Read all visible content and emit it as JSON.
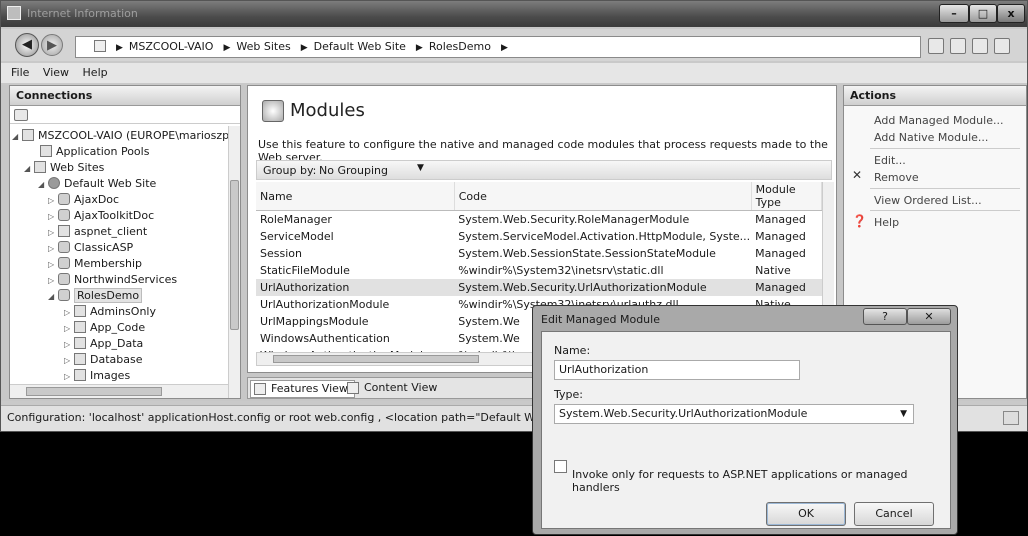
{
  "window": {
    "title": "Internet Information"
  },
  "address": {
    "crumbs": [
      "MSZCOOL-VAIO",
      "Web Sites",
      "Default Web Site",
      "RolesDemo"
    ]
  },
  "menu": [
    "File",
    "View",
    "Help"
  ],
  "connections": {
    "title": "Connections",
    "tree": [
      {
        "label": "MSZCOOL-VAIO (EUROPE\\marioszp)",
        "expander": "◢",
        "icon": "server-icon"
      },
      {
        "label": "Application Pools",
        "expander": "",
        "icon": "folder-icon"
      },
      {
        "label": "Web Sites",
        "expander": "◢",
        "icon": "folder-icon"
      },
      {
        "label": "Default Web Site",
        "expander": "◢",
        "icon": "globe-icon"
      },
      {
        "label": "AjaxDoc",
        "expander": "▷",
        "icon": "app-icon"
      },
      {
        "label": "AjaxToolkitDoc",
        "expander": "▷",
        "icon": "app-icon"
      },
      {
        "label": "aspnet_client",
        "expander": "▷",
        "icon": "folder-icon"
      },
      {
        "label": "ClassicASP",
        "expander": "▷",
        "icon": "app-icon"
      },
      {
        "label": "Membership",
        "expander": "▷",
        "icon": "app-icon"
      },
      {
        "label": "NorthwindServices",
        "expander": "▷",
        "icon": "app-icon"
      },
      {
        "label": "RolesDemo",
        "expander": "◢",
        "icon": "app-icon"
      },
      {
        "label": "AdminsOnly",
        "expander": "▷",
        "icon": "folder-icon"
      },
      {
        "label": "App_Code",
        "expander": "▷",
        "icon": "folder-icon"
      },
      {
        "label": "App_Data",
        "expander": "▷",
        "icon": "folder-icon"
      },
      {
        "label": "Database",
        "expander": "▷",
        "icon": "folder-icon"
      },
      {
        "label": "Images",
        "expander": "▷",
        "icon": "folder-icon"
      }
    ]
  },
  "main": {
    "title": "Modules",
    "description": "Use this feature to configure the native and managed code modules that process requests made to the Web server.",
    "group_by_label": "Group by:",
    "group_by_value": "No Grouping",
    "columns": [
      "Name",
      "Code",
      "Module Type"
    ],
    "rows": [
      [
        "RoleManager",
        "System.Web.Security.RoleManagerModule",
        "Managed"
      ],
      [
        "ServiceModel",
        "System.ServiceModel.Activation.HttpModule, Syste...",
        "Managed"
      ],
      [
        "Session",
        "System.Web.SessionState.SessionStateModule",
        "Managed"
      ],
      [
        "StaticFileModule",
        "%windir%\\System32\\inetsrv\\static.dll",
        "Native"
      ],
      [
        "UrlAuthorization",
        "System.Web.Security.UrlAuthorizationModule",
        "Managed"
      ],
      [
        "UrlAuthorizationModule",
        "%windir%\\System32\\inetsrv\\urlauthz.dll",
        "Native"
      ],
      [
        "UrlMappingsModule",
        "System.We",
        ""
      ],
      [
        "WindowsAuthentication",
        "System.We",
        ""
      ],
      [
        "WindowsAuthenticationModule",
        "%windir%\\",
        ""
      ]
    ],
    "selected_row": 4,
    "tabs": [
      "Features View",
      "Content View"
    ]
  },
  "actions": {
    "title": "Actions",
    "items": [
      "Add Managed Module...",
      "Add Native Module...",
      "Edit...",
      "Remove",
      "View Ordered List...",
      "Help"
    ]
  },
  "status": "Configuration: 'localhost' applicationHost.config or root web.config , <location path=\"Default Web Site/RolesI",
  "dialog": {
    "title": "Edit Managed Module",
    "name_label": "Name:",
    "name_value": "UrlAuthorization",
    "type_label": "Type:",
    "type_value": "System.Web.Security.UrlAuthorizationModule",
    "checkbox_label": "Invoke only for requests to ASP.NET applications or managed handlers",
    "checkbox_checked": false,
    "ok": "OK",
    "cancel": "Cancel"
  }
}
